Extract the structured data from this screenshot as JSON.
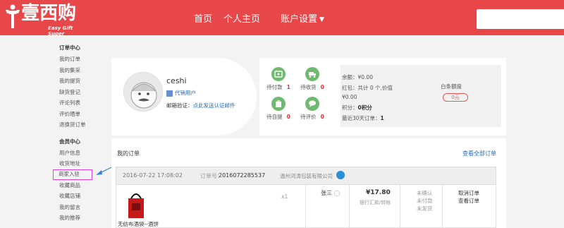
{
  "header": {
    "logo_cn": "壹西购",
    "logo_en": "Easy Gift Super",
    "nav": {
      "home": "首页",
      "personal": "个人主页",
      "account": "账户设置"
    },
    "search_placeholder": ""
  },
  "sidebar": {
    "groups": [
      {
        "title": "订单中心",
        "items": [
          "我的订单",
          "我的集采",
          "我的提货",
          "缺货登记",
          "评论列表",
          "评价晒单",
          "退换货订单"
        ]
      },
      {
        "title": "会员中心",
        "items": [
          "用户信息",
          "收货地址",
          "商家入驻",
          "收藏商品",
          "收藏店铺",
          "我的留言",
          "我的推荐"
        ]
      }
    ],
    "highlighted_item": "商家入驻"
  },
  "profile": {
    "username": "ceshi",
    "role": "代销用户",
    "email_label": "邮箱验证：",
    "email_link": "点此发送认证邮件"
  },
  "order_status": [
    {
      "label": "待付款",
      "count": "1",
      "icon": "wallet-icon"
    },
    {
      "label": "待收货",
      "count": "0",
      "icon": "truck-icon"
    },
    {
      "label": "待自提",
      "count": "0",
      "icon": "bag-icon"
    },
    {
      "label": "待评价",
      "count": "0",
      "icon": "chat-icon"
    }
  ],
  "wallet": {
    "balance": "余额：¥0.00",
    "bonus": "红包：共计 0 个,价值",
    "bonus_value": "¥0.00",
    "points_label": "积分：",
    "points": "0积分",
    "recent_label": "最近30天订单：",
    "recent_count": "1",
    "white_label": "白条额度",
    "white_value": "0元"
  },
  "orders": {
    "title": "我的订单",
    "view_all": "查看全部订单",
    "list": [
      {
        "date": "2016-07-22 17:08:02",
        "no_label": "订单号：",
        "no": "2016072285537",
        "shop": "温州鸿涛包装有限公司",
        "product_name": "无纺布酒袋--酒饼",
        "qty": "x1",
        "buyer": "张三",
        "price": "¥17.80",
        "pay_type": "银行汇款/转帐",
        "states": [
          "未确认",
          "未付款",
          "未发货"
        ],
        "actions": [
          "取消订单",
          "查看订单"
        ]
      }
    ]
  },
  "colors": {
    "brand_red": "#e8474a",
    "status_green": "#6fba6e",
    "link_blue": "#2a6ac0",
    "highlight_magenta": "#e040e0"
  }
}
